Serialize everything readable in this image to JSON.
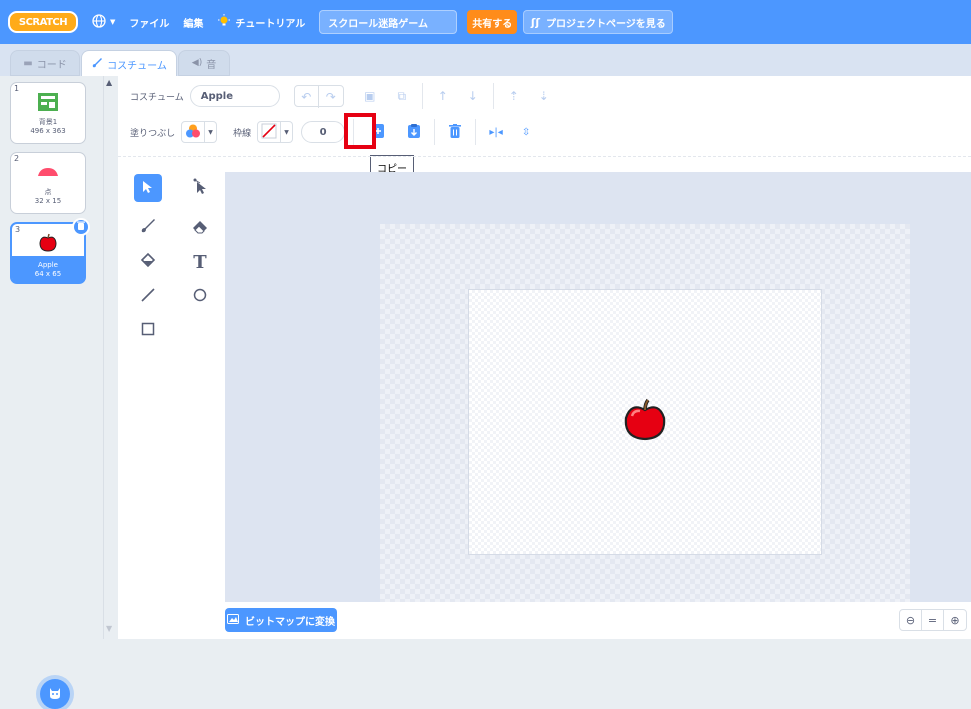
{
  "menubar": {
    "logo": "SCRATCH",
    "file": "ファイル",
    "edit": "編集",
    "tutorial": "チュートリアル",
    "project_title": "スクロール迷路ゲーム",
    "share": "共有する",
    "project_page": "プロジェクトページを見る"
  },
  "tabs": {
    "code": "コード",
    "costume": "コスチューム",
    "sound": "音"
  },
  "costumes": [
    {
      "num": "1",
      "name": "背景1",
      "size": "496 x 363"
    },
    {
      "num": "2",
      "name": "点",
      "size": "32 x 15"
    },
    {
      "num": "3",
      "name": "Apple",
      "size": "64 x 65"
    }
  ],
  "toolbar": {
    "costume_label": "コスチューム",
    "costume_name": "Apple",
    "fill_label": "塗りつぶし",
    "outline_label": "枠線",
    "outline_width": "0"
  },
  "tooltip": "コピー",
  "bottom": {
    "bitmap_button": "ビットマップに変換"
  },
  "colors": {
    "accent": "#4c97ff",
    "highlight": "#e60012",
    "share": "#ff8c1a"
  }
}
